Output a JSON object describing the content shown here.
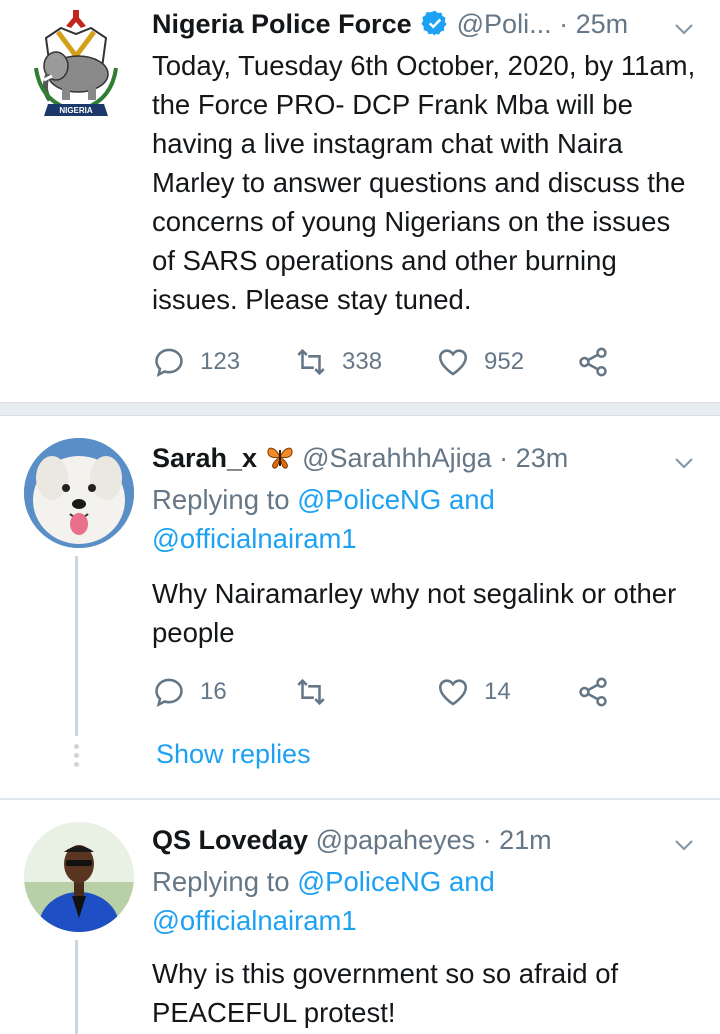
{
  "tweets": [
    {
      "name": "Nigeria Police Force",
      "handle": "@Poli...",
      "time": "25m",
      "text": "Today, Tuesday 6th October,  2020, by 11am, the Force PRO- DCP Frank Mba will be having a live instagram chat with Naira Marley to answer questions and discuss the concerns of young Nigerians on the issues of SARS operations and other burning issues. Please stay tuned.",
      "replies": "123",
      "retweets": "338",
      "likes": "952",
      "avatar_caption": "NIGERIA"
    },
    {
      "name": "Sarah_x",
      "handle": "@SarahhhAjiga",
      "time": "23m",
      "replying_label": "Replying to",
      "replying_1": "@PoliceNG",
      "replying_and": "and",
      "replying_2": "@officialnairam1",
      "text": "Why Nairamarley why not segalink or other people",
      "replies": "16",
      "retweets": "",
      "likes": "14",
      "show_replies": "Show replies"
    },
    {
      "name": "QS Loveday",
      "handle": "@papaheyes",
      "time": "21m",
      "replying_label": "Replying to",
      "replying_1": "@PoliceNG",
      "replying_and": "and",
      "replying_2": "@officialnairam1",
      "text": "Why is this government so so afraid of PEACEFUL protest!"
    }
  ],
  "separator": "·",
  "colors": {
    "accent": "#1da1f2",
    "muted": "#657786",
    "text": "#14171a",
    "verified": "#1da1f2",
    "divider": "#e6ecf0"
  },
  "icons": [
    "chevron-down-icon",
    "verified-badge-icon",
    "reply-icon",
    "retweet-icon",
    "like-icon",
    "share-icon",
    "butterfly-emoji-icon"
  ]
}
